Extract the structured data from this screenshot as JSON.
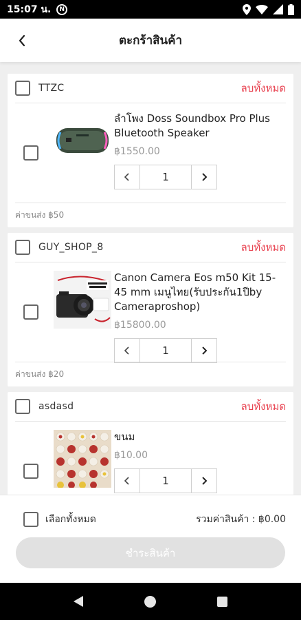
{
  "status_bar": {
    "time": "15:07 น.",
    "badge": "N"
  },
  "header": {
    "title": "ตะกร้าสินค้า"
  },
  "shops": [
    {
      "name": "TTZC",
      "delete_all": "ลบทั้งหมด",
      "item": {
        "name": "ลำโพง Doss Soundbox Pro Plus Bluetooth Speaker",
        "price": "฿1550.00",
        "quantity": "1"
      },
      "shipping": "ค่าขนส่ง ฿50"
    },
    {
      "name": "GUY_SHOP_8",
      "delete_all": "ลบทั้งหมด",
      "item": {
        "name": "Canon Camera Eos m50 Kit 15-45 mm เมนูไทย(รับประกัน1ปีby Cameraproshop)",
        "price": "฿15800.00",
        "quantity": "1"
      },
      "shipping": "ค่าขนส่ง ฿20"
    },
    {
      "name": "asdasd",
      "delete_all": "ลบทั้งหมด",
      "item": {
        "name": "ขนม",
        "price": "฿10.00",
        "quantity": "1"
      },
      "shipping": ""
    }
  ],
  "footer": {
    "select_all": "เลือกทั้งหมด",
    "total": "รวมค่าสินค้า : ฿0.00",
    "checkout": "ชำระสินค้า"
  },
  "colors": {
    "accent_red": "#e8414f",
    "disabled_button": "#e1e1e1"
  }
}
